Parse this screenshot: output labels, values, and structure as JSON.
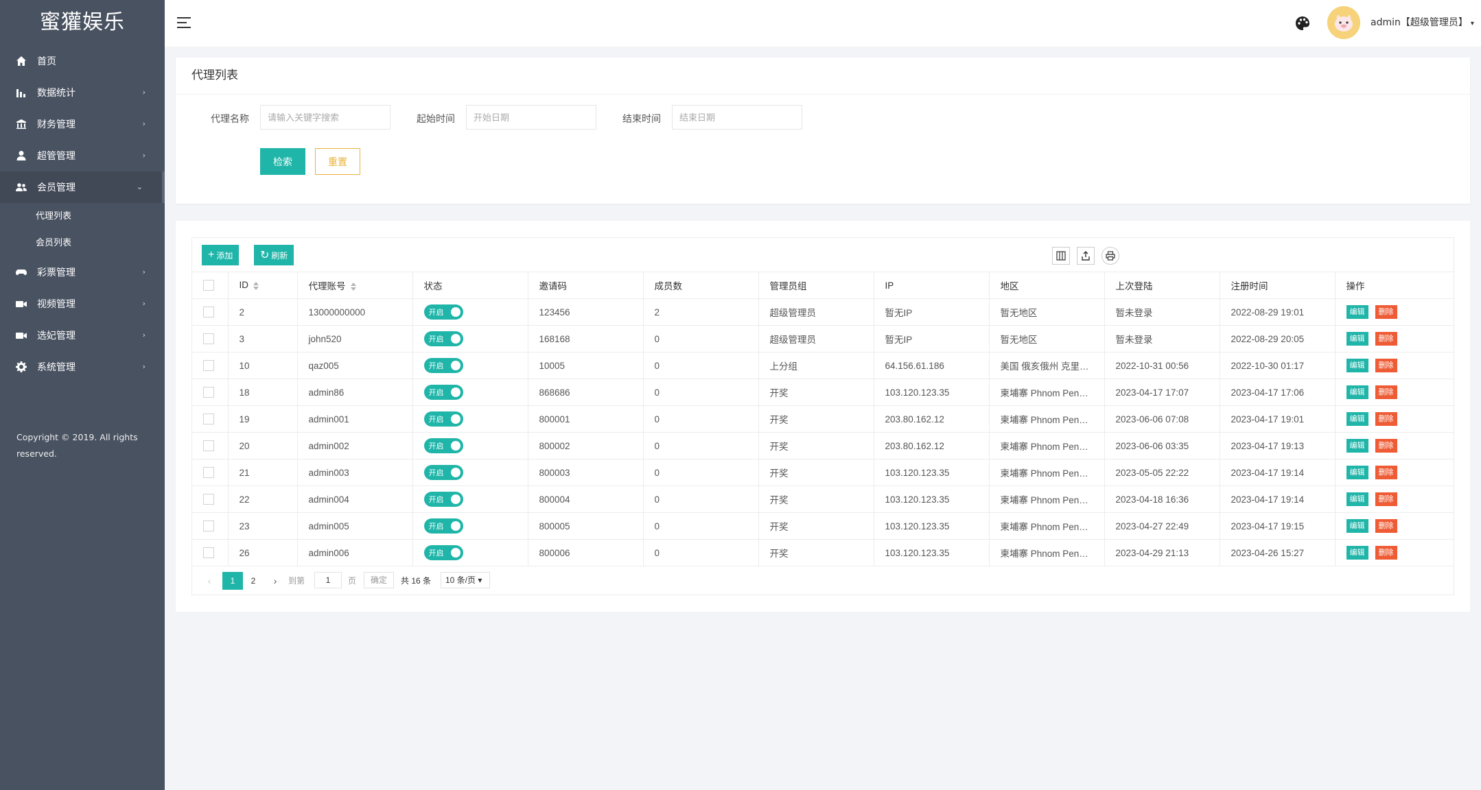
{
  "sidebar": {
    "logo": "蜜獾娱乐",
    "items": [
      {
        "label": "首页",
        "arrow": ""
      },
      {
        "label": "数据统计",
        "arrow": "›"
      },
      {
        "label": "财务管理",
        "arrow": "›"
      },
      {
        "label": "超管管理",
        "arrow": "›"
      },
      {
        "label": "会员管理",
        "arrow": "⌄"
      },
      {
        "label": "彩票管理",
        "arrow": "›"
      },
      {
        "label": "视频管理",
        "arrow": "›"
      },
      {
        "label": "选妃管理",
        "arrow": "›"
      },
      {
        "label": "系统管理",
        "arrow": "›"
      }
    ],
    "sub_items": [
      {
        "label": "代理列表"
      },
      {
        "label": "会员列表"
      }
    ],
    "copyright": "Copyright © 2019. All rights reserved."
  },
  "header": {
    "user": "admin【超级管理员】",
    "user_caret": "▾"
  },
  "search": {
    "title": "代理列表",
    "name_label": "代理名称",
    "name_placeholder": "请输入关键字搜索",
    "start_label": "起始时间",
    "start_placeholder": "开始日期",
    "end_label": "结束时间",
    "end_placeholder": "结束日期",
    "search_btn": "检索",
    "reset_btn": "重置"
  },
  "toolbar": {
    "add": "添加",
    "add_glyph": "+",
    "refresh": "刷新",
    "refresh_glyph": "↻"
  },
  "table": {
    "headers": [
      "ID",
      "代理账号",
      "状态",
      "邀请码",
      "成员数",
      "管理员组",
      "IP",
      "地区",
      "上次登陆",
      "注册时间",
      "操作"
    ],
    "switch_label": "开启",
    "edit_label": "编辑",
    "delete_label": "删除",
    "rows": [
      {
        "id": "2",
        "account": "13000000000",
        "code": "123456",
        "members": "2",
        "group": "超级管理员",
        "ip": "暂无IP",
        "region": "暂无地区",
        "last_login": "暂未登录",
        "registered": "2022-08-29 19:01"
      },
      {
        "id": "3",
        "account": "john520",
        "code": "168168",
        "members": "0",
        "group": "超级管理员",
        "ip": "暂无IP",
        "region": "暂无地区",
        "last_login": "暂未登录",
        "registered": "2022-08-29 20:05"
      },
      {
        "id": "10",
        "account": "qaz005",
        "code": "10005",
        "members": "0",
        "group": "上分组",
        "ip": "64.156.61.186",
        "region": "美国 俄亥俄州 克里…",
        "last_login": "2022-10-31 00:56",
        "registered": "2022-10-30 01:17"
      },
      {
        "id": "18",
        "account": "admin86",
        "code": "868686",
        "members": "0",
        "group": "开奖",
        "ip": "103.120.123.35",
        "region": "柬埔寨 Phnom Pen…",
        "last_login": "2023-04-17 17:07",
        "registered": "2023-04-17 17:06"
      },
      {
        "id": "19",
        "account": "admin001",
        "code": "800001",
        "members": "0",
        "group": "开奖",
        "ip": "203.80.162.12",
        "region": "柬埔寨 Phnom Pen…",
        "last_login": "2023-06-06 07:08",
        "registered": "2023-04-17 19:01"
      },
      {
        "id": "20",
        "account": "admin002",
        "code": "800002",
        "members": "0",
        "group": "开奖",
        "ip": "203.80.162.12",
        "region": "柬埔寨 Phnom Pen…",
        "last_login": "2023-06-06 03:35",
        "registered": "2023-04-17 19:13"
      },
      {
        "id": "21",
        "account": "admin003",
        "code": "800003",
        "members": "0",
        "group": "开奖",
        "ip": "103.120.123.35",
        "region": "柬埔寨 Phnom Pen…",
        "last_login": "2023-05-05 22:22",
        "registered": "2023-04-17 19:14"
      },
      {
        "id": "22",
        "account": "admin004",
        "code": "800004",
        "members": "0",
        "group": "开奖",
        "ip": "103.120.123.35",
        "region": "柬埔寨 Phnom Pen…",
        "last_login": "2023-04-18 16:36",
        "registered": "2023-04-17 19:14"
      },
      {
        "id": "23",
        "account": "admin005",
        "code": "800005",
        "members": "0",
        "group": "开奖",
        "ip": "103.120.123.35",
        "region": "柬埔寨 Phnom Pen…",
        "last_login": "2023-04-27 22:49",
        "registered": "2023-04-17 19:15"
      },
      {
        "id": "26",
        "account": "admin006",
        "code": "800006",
        "members": "0",
        "group": "开奖",
        "ip": "103.120.123.35",
        "region": "柬埔寨 Phnom Pen…",
        "last_login": "2023-04-29 21:13",
        "registered": "2023-04-26 15:27"
      }
    ]
  },
  "pager": {
    "prev": "‹",
    "pages": [
      "1",
      "2"
    ],
    "current": "1",
    "next": "›",
    "goto_label": "到第",
    "goto_value": "1",
    "page_label": "页",
    "confirm": "确定",
    "total": "共 16 条",
    "page_size": "10 条/页",
    "size_caret": "▾"
  },
  "colors": {
    "sidebar_bg": "#495261",
    "accent": "#1fb5a8",
    "danger": "#ef5b34",
    "warning": "#e8b33c"
  },
  "icons": [
    "home-icon",
    "bar-chart-icon",
    "bank-icon",
    "user-icon",
    "users-icon",
    "gamepad-icon",
    "video-icon",
    "video-icon",
    "gear-icon",
    "menu-icon",
    "palette-icon",
    "avatar-icon",
    "columns-icon",
    "export-icon",
    "print-icon"
  ]
}
